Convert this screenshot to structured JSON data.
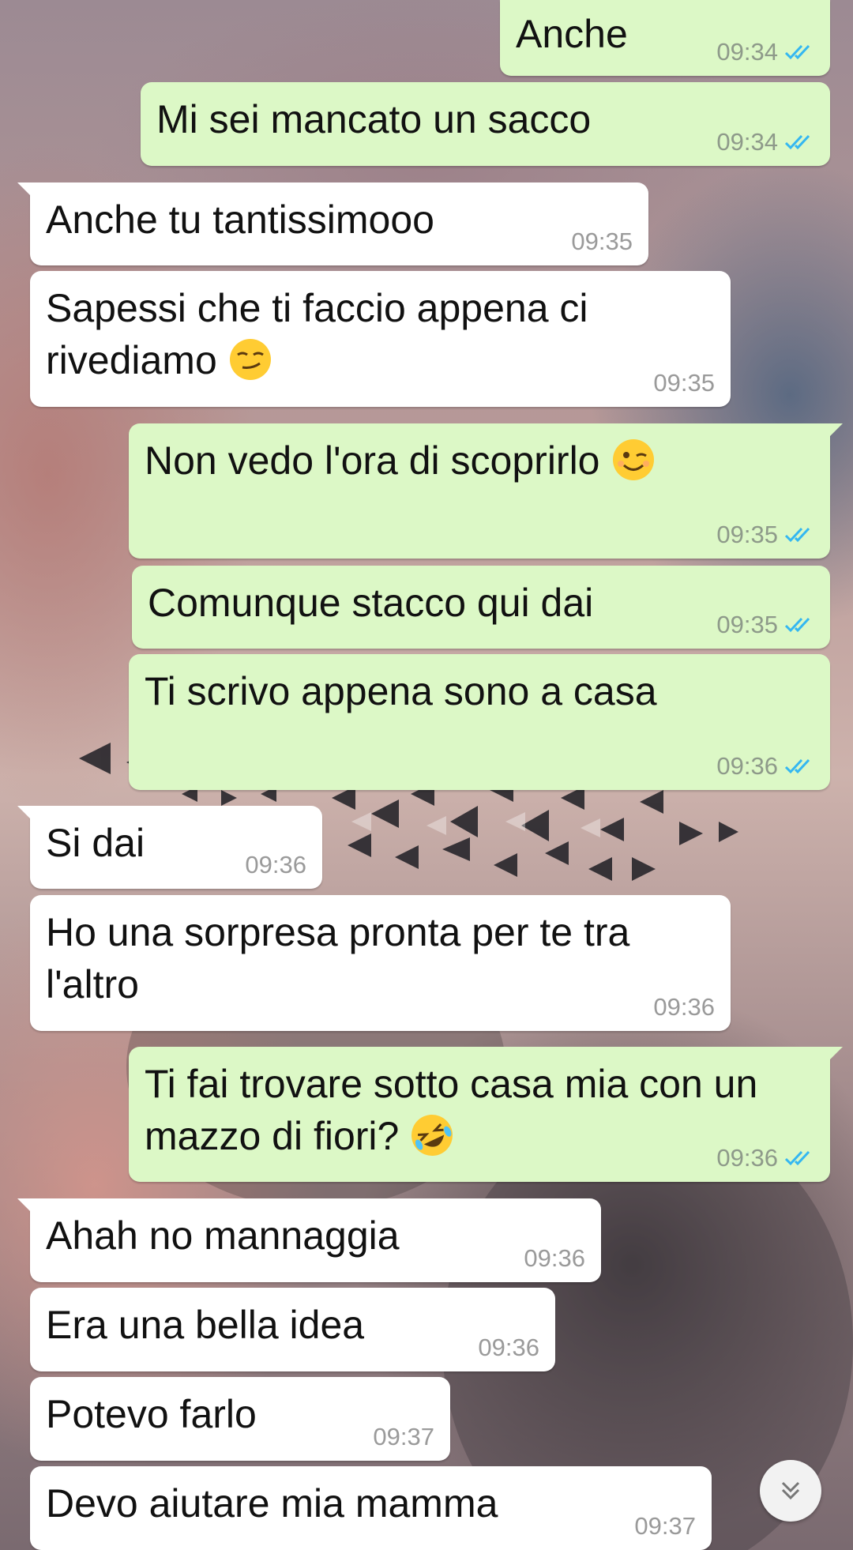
{
  "messages": [
    {
      "dir": "out",
      "text": "Anche",
      "time": "09:34",
      "status_icon": "double-check-read-icon"
    },
    {
      "dir": "out",
      "text": "Mi sei mancato un sacco",
      "time": "09:34",
      "status_icon": "double-check-read-icon"
    },
    {
      "dir": "in",
      "text": "Anche tu tantissimooo",
      "time": "09:35"
    },
    {
      "dir": "in",
      "text": "Sapessi che ti faccio appena ci rivediamo",
      "emoji": "smirking-face-emoji",
      "time": "09:35"
    },
    {
      "dir": "out",
      "text": "Non vedo l'ora di scoprirlo",
      "emoji": "winking-face-emoji",
      "time": "09:35",
      "status_icon": "double-check-read-icon"
    },
    {
      "dir": "out",
      "text": "Comunque stacco qui dai",
      "time": "09:35",
      "status_icon": "double-check-read-icon"
    },
    {
      "dir": "out",
      "text": "Ti scrivo appena sono a casa",
      "time": "09:36",
      "status_icon": "double-check-read-icon"
    },
    {
      "dir": "in",
      "text": "Si dai",
      "time": "09:36"
    },
    {
      "dir": "in",
      "text": "Ho una sorpresa pronta per te tra l'altro",
      "time": "09:36"
    },
    {
      "dir": "out",
      "text": "Ti fai trovare sotto casa mia con un mazzo di fiori?",
      "emoji": "rolling-on-floor-laughing-emoji",
      "time": "09:36",
      "status_icon": "double-check-read-icon"
    },
    {
      "dir": "in",
      "text": "Ahah no mannaggia",
      "time": "09:36"
    },
    {
      "dir": "in",
      "text": "Era una bella idea",
      "time": "09:36"
    },
    {
      "dir": "in",
      "text": "Potevo farlo",
      "time": "09:37"
    },
    {
      "dir": "in",
      "text": "Devo aiutare mia mamma",
      "time": "09:37"
    }
  ],
  "scroll_button": {
    "icon": "double-chevron-down-icon"
  },
  "colors": {
    "outgoing_bubble": "#dcf8c6",
    "incoming_bubble": "#ffffff",
    "read_tick": "#34b7f1"
  }
}
